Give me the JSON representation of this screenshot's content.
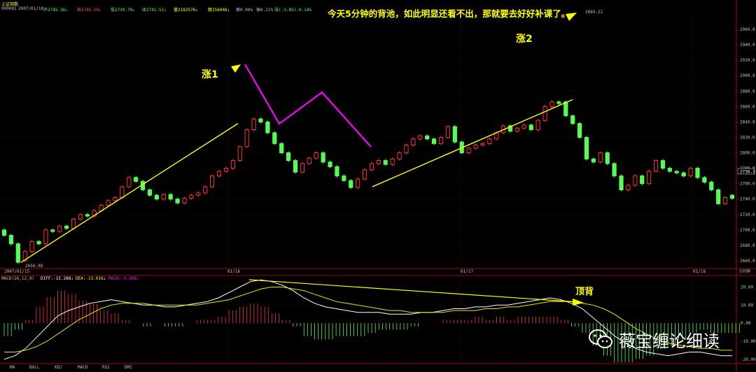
{
  "header": {
    "name": "上证指数",
    "code": "000001",
    "date": "2007/01/18",
    "open": "开2745.36↓",
    "high": "高2745.59↓",
    "low": "低2739.70↓",
    "close": "收2741.52↓",
    "volume": "量2182576↓",
    "amount": "额156048↓",
    "turnover": "换0.00%",
    "amplitude": "振0.21%",
    "change": "涨(-3.85)-0.14%"
  },
  "annotations": {
    "title_note": "今天5分钟的背池，如此明显还看不出，那就要去好好补课了。",
    "rise1": "涨1",
    "rise2": "涨2",
    "divergence": "顶背"
  },
  "price_labels": {
    "low_mark": "2656.98",
    "high_mark": "2869.22",
    "current": "2736.1"
  },
  "date_labels": [
    "2007/01/15",
    "01/16",
    "01/17",
    "01/18"
  ],
  "period": "5分钟",
  "indicator": {
    "name": "MACD(26,12,9)",
    "diff": "DIFF:-15.288↓",
    "dea": "DEA:-13.016↓",
    "macd": "MACD:-4.368↓"
  },
  "tabs": [
    "MA",
    "BOLL",
    "KDJ",
    "MACD",
    "RSI",
    "DMI"
  ],
  "watermark": "薇宝缠论细读",
  "colors": {
    "up": "#ff3232",
    "down": "#54ff54",
    "axis": "#b00000",
    "yellow": "#ffff00",
    "magenta": "#ff00ff",
    "diff_line": "#ffffff",
    "dea_line": "#e6e600"
  },
  "chart_data": [
    {
      "type": "candlestick",
      "title": "上证指数",
      "period": "5分钟",
      "ylim": [
        2650,
        2980
      ],
      "y_ticks": [
        2660,
        2680,
        2700,
        2720,
        2740,
        2760,
        2780,
        2800,
        2820,
        2840,
        2860,
        2880,
        2900,
        2920,
        2940,
        2960
      ],
      "x_labels": [
        "2007/01/15",
        "01/16",
        "01/17",
        "01/18"
      ],
      "annotations": [
        "涨1",
        "涨2",
        "今天5分钟的背池，如此明显还看不出，那就要去好好补课了。"
      ],
      "candles": [
        {
          "o": 2700,
          "c": 2693
        },
        {
          "o": 2693,
          "c": 2682
        },
        {
          "o": 2682,
          "c": 2658
        },
        {
          "o": 2660,
          "c": 2672
        },
        {
          "o": 2672,
          "c": 2685
        },
        {
          "o": 2685,
          "c": 2682
        },
        {
          "o": 2682,
          "c": 2700
        },
        {
          "o": 2700,
          "c": 2698
        },
        {
          "o": 2698,
          "c": 2705
        },
        {
          "o": 2705,
          "c": 2702
        },
        {
          "o": 2702,
          "c": 2714
        },
        {
          "o": 2714,
          "c": 2720
        },
        {
          "o": 2720,
          "c": 2718
        },
        {
          "o": 2718,
          "c": 2725
        },
        {
          "o": 2725,
          "c": 2732
        },
        {
          "o": 2732,
          "c": 2738
        },
        {
          "o": 2738,
          "c": 2742
        },
        {
          "o": 2742,
          "c": 2756
        },
        {
          "o": 2756,
          "c": 2768
        },
        {
          "o": 2768,
          "c": 2763
        },
        {
          "o": 2763,
          "c": 2752
        },
        {
          "o": 2752,
          "c": 2745
        },
        {
          "o": 2745,
          "c": 2740
        },
        {
          "o": 2740,
          "c": 2746
        },
        {
          "o": 2746,
          "c": 2740
        },
        {
          "o": 2740,
          "c": 2735
        },
        {
          "o": 2735,
          "c": 2741
        },
        {
          "o": 2741,
          "c": 2745
        },
        {
          "o": 2745,
          "c": 2748
        },
        {
          "o": 2748,
          "c": 2756
        },
        {
          "o": 2756,
          "c": 2770
        },
        {
          "o": 2770,
          "c": 2776
        },
        {
          "o": 2776,
          "c": 2780
        },
        {
          "o": 2780,
          "c": 2790
        },
        {
          "o": 2790,
          "c": 2808
        },
        {
          "o": 2808,
          "c": 2830
        },
        {
          "o": 2830,
          "c": 2844
        },
        {
          "o": 2844,
          "c": 2840
        },
        {
          "o": 2840,
          "c": 2826
        },
        {
          "o": 2826,
          "c": 2812
        },
        {
          "o": 2812,
          "c": 2800
        },
        {
          "o": 2800,
          "c": 2790
        },
        {
          "o": 2790,
          "c": 2775
        },
        {
          "o": 2775,
          "c": 2786
        },
        {
          "o": 2786,
          "c": 2793
        },
        {
          "o": 2793,
          "c": 2800
        },
        {
          "o": 2800,
          "c": 2788
        },
        {
          "o": 2788,
          "c": 2782
        },
        {
          "o": 2782,
          "c": 2770
        },
        {
          "o": 2770,
          "c": 2764
        },
        {
          "o": 2764,
          "c": 2755
        },
        {
          "o": 2755,
          "c": 2766
        },
        {
          "o": 2766,
          "c": 2778
        },
        {
          "o": 2778,
          "c": 2786
        },
        {
          "o": 2786,
          "c": 2790
        },
        {
          "o": 2790,
          "c": 2785
        },
        {
          "o": 2785,
          "c": 2792
        },
        {
          "o": 2792,
          "c": 2800
        },
        {
          "o": 2800,
          "c": 2810
        },
        {
          "o": 2810,
          "c": 2818
        },
        {
          "o": 2818,
          "c": 2822
        },
        {
          "o": 2822,
          "c": 2818
        },
        {
          "o": 2818,
          "c": 2812
        },
        {
          "o": 2812,
          "c": 2820
        },
        {
          "o": 2820,
          "c": 2834
        },
        {
          "o": 2834,
          "c": 2814
        },
        {
          "o": 2814,
          "c": 2800
        },
        {
          "o": 2800,
          "c": 2806
        },
        {
          "o": 2806,
          "c": 2810
        },
        {
          "o": 2810,
          "c": 2812
        },
        {
          "o": 2812,
          "c": 2818
        },
        {
          "o": 2818,
          "c": 2826
        },
        {
          "o": 2826,
          "c": 2835
        },
        {
          "o": 2835,
          "c": 2828
        },
        {
          "o": 2828,
          "c": 2832
        },
        {
          "o": 2832,
          "c": 2836
        },
        {
          "o": 2836,
          "c": 2830
        },
        {
          "o": 2830,
          "c": 2842
        },
        {
          "o": 2842,
          "c": 2860
        },
        {
          "o": 2860,
          "c": 2866
        },
        {
          "o": 2866,
          "c": 2864
        },
        {
          "o": 2866,
          "c": 2848
        },
        {
          "o": 2848,
          "c": 2838
        },
        {
          "o": 2838,
          "c": 2820
        },
        {
          "o": 2820,
          "c": 2792
        },
        {
          "o": 2792,
          "c": 2788
        },
        {
          "o": 2788,
          "c": 2800
        },
        {
          "o": 2800,
          "c": 2786
        },
        {
          "o": 2786,
          "c": 2770
        },
        {
          "o": 2770,
          "c": 2752
        },
        {
          "o": 2752,
          "c": 2758
        },
        {
          "o": 2758,
          "c": 2770
        },
        {
          "o": 2770,
          "c": 2760
        },
        {
          "o": 2760,
          "c": 2776
        },
        {
          "o": 2776,
          "c": 2790
        },
        {
          "o": 2790,
          "c": 2780
        },
        {
          "o": 2780,
          "c": 2776
        },
        {
          "o": 2776,
          "c": 2774
        },
        {
          "o": 2774,
          "c": 2770
        },
        {
          "o": 2770,
          "c": 2780
        },
        {
          "o": 2780,
          "c": 2768
        },
        {
          "o": 2768,
          "c": 2762
        },
        {
          "o": 2762,
          "c": 2752
        },
        {
          "o": 2752,
          "c": 2734
        },
        {
          "o": 2734,
          "c": 2742
        },
        {
          "o": 2745,
          "c": 2741
        }
      ]
    },
    {
      "type": "line+bar",
      "title": "MACD(26,12,9)",
      "ylim": [
        -22,
        26
      ],
      "y_ticks": [
        -20,
        -10,
        0,
        10,
        20
      ],
      "annotations": [
        "顶背"
      ],
      "series": [
        {
          "name": "DIFF",
          "values": [
            -20,
            -18,
            -14,
            -8,
            -2,
            4,
            7,
            9,
            11,
            12,
            13,
            12,
            11,
            10,
            10,
            9,
            9,
            10,
            11,
            12,
            14,
            17,
            20,
            23,
            24,
            23,
            21,
            18,
            14,
            11,
            9,
            8,
            7,
            6,
            6,
            6,
            5,
            5,
            5,
            6,
            6,
            7,
            8,
            8,
            9,
            9,
            10,
            10,
            11,
            12,
            13,
            14,
            13,
            11,
            8,
            3,
            -2,
            -7,
            -11,
            -14,
            -16,
            -17,
            -18,
            -17,
            -16,
            -16,
            -17,
            -18,
            -18
          ]
        },
        {
          "name": "DEA",
          "values": [
            -16,
            -16,
            -15,
            -13,
            -10,
            -6,
            -2,
            2,
            5,
            8,
            10,
            11,
            11,
            11,
            10,
            10,
            10,
            10,
            10,
            11,
            12,
            13,
            15,
            17,
            19,
            20,
            20,
            19,
            18,
            16,
            14,
            12,
            11,
            10,
            9,
            8,
            7,
            7,
            6,
            6,
            6,
            6,
            7,
            7,
            7,
            8,
            8,
            9,
            9,
            10,
            11,
            12,
            12,
            12,
            11,
            10,
            8,
            5,
            1,
            -3,
            -6,
            -9,
            -11,
            -12,
            -13,
            -14,
            -14,
            -15,
            -15
          ]
        },
        {
          "name": "MACD",
          "values": [
            -8,
            -4,
            2,
            10,
            16,
            20,
            18,
            14,
            12,
            8,
            6,
            2,
            0,
            -2,
            0,
            -2,
            -2,
            0,
            2,
            2,
            4,
            8,
            10,
            12,
            10,
            6,
            2,
            -2,
            -8,
            -10,
            -10,
            -8,
            -8,
            -8,
            -6,
            -4,
            -4,
            -4,
            -2,
            0,
            0,
            2,
            2,
            2,
            4,
            2,
            4,
            2,
            4,
            4,
            4,
            4,
            2,
            -2,
            -6,
            -14,
            -20,
            -24,
            -24,
            -22,
            -20,
            -16,
            -14,
            -10,
            -6,
            -4,
            -6,
            -6,
            -6
          ]
        }
      ]
    }
  ]
}
